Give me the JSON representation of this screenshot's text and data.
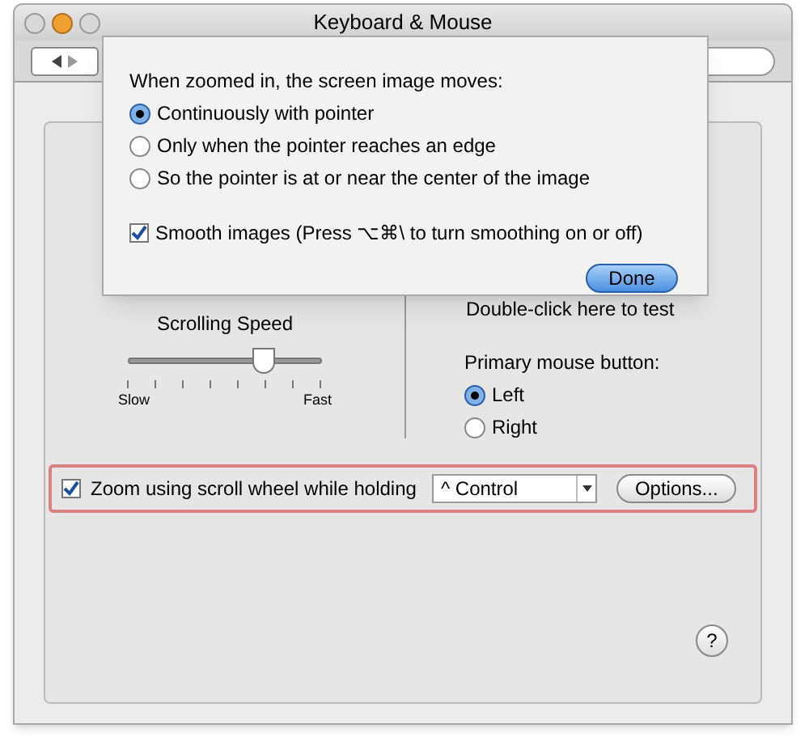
{
  "window": {
    "title": "Keyboard & Mouse"
  },
  "sheet": {
    "prompt": "When zoomed in, the screen image moves:",
    "options": [
      {
        "label": "Continuously with pointer",
        "selected": true
      },
      {
        "label": "Only when the pointer reaches an edge",
        "selected": false
      },
      {
        "label": "So the pointer is at or near the center of the image",
        "selected": false
      }
    ],
    "smooth": {
      "label": "Smooth images (Press ⌥⌘\\ to turn smoothing on or off)",
      "checked": true
    },
    "done": "Done"
  },
  "double_click_test": "Double-click here to test",
  "scrolling_speed": {
    "title": "Scrolling Speed",
    "level": 0.7,
    "min_label": "Slow",
    "max_label": "Fast"
  },
  "primary_button": {
    "label": "Primary mouse button:",
    "options": [
      {
        "label": "Left",
        "selected": true
      },
      {
        "label": "Right",
        "selected": false
      }
    ]
  },
  "zoom": {
    "label": "Zoom using scroll wheel while holding",
    "checked": true,
    "modifier": "^ Control",
    "options_button": "Options..."
  },
  "help": "?"
}
